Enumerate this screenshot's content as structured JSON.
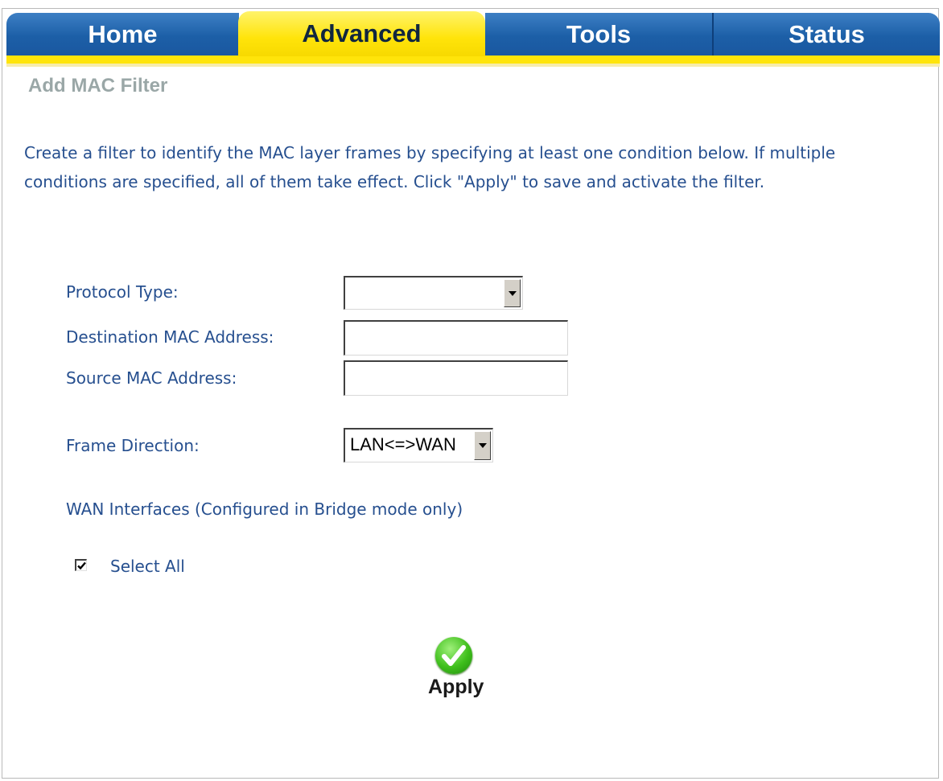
{
  "tabs": [
    "Home",
    "Advanced",
    "Tools",
    "Status"
  ],
  "page_title": "Add MAC Filter",
  "description": "Create a filter to identify the MAC layer frames by specifying at least one condition below. If multiple conditions are specified, all of them take effect. Click \"Apply\" to save and activate the filter.",
  "form": {
    "protocol_label": "Protocol Type:",
    "protocol_value": "",
    "dest_mac_label": "Destination MAC Address:",
    "dest_mac_value": "",
    "src_mac_label": "Source MAC Address:",
    "src_mac_value": "",
    "direction_label": "Frame Direction:",
    "direction_value": "LAN<=>WAN",
    "wan_label": "WAN Interfaces (Configured in Bridge mode only)",
    "select_all_label": "Select All",
    "select_all_checked": true
  },
  "apply_label": "Apply"
}
